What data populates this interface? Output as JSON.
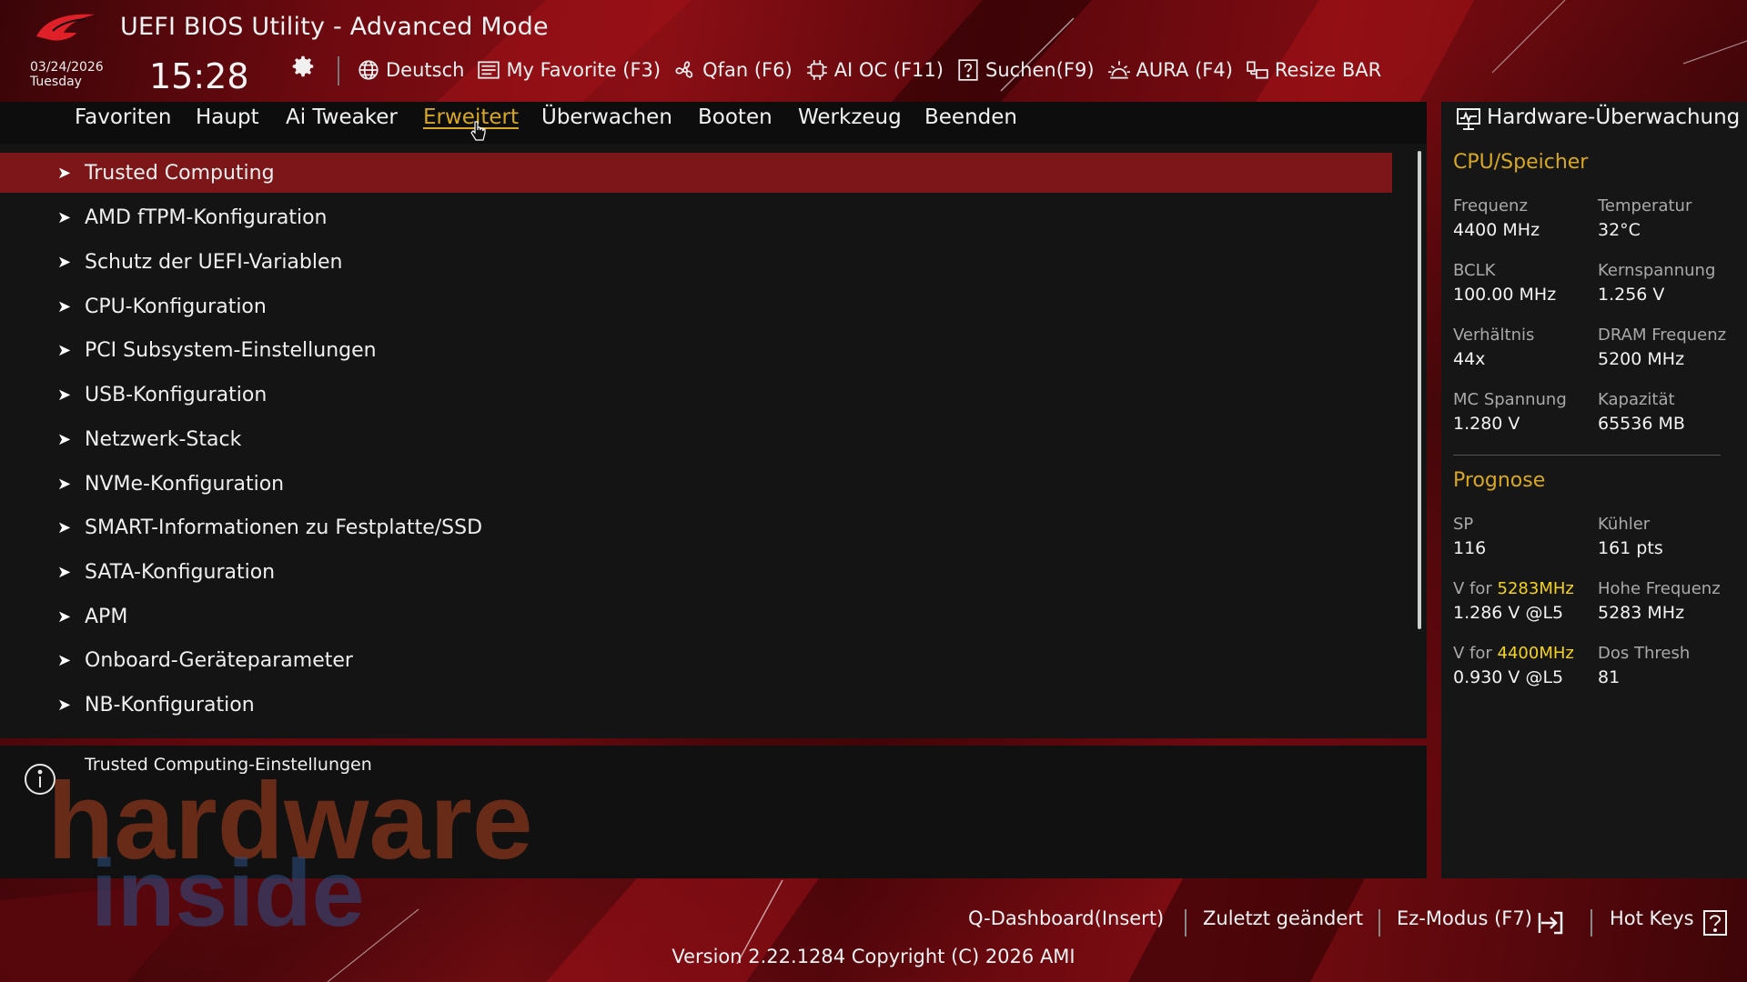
{
  "header": {
    "title": "UEFI BIOS Utility - Advanced Mode",
    "date": "03/24/2026",
    "weekday": "Tuesday",
    "time": "15:28",
    "toolbar": [
      {
        "label": "Deutsch",
        "icon": "globe-icon"
      },
      {
        "label": "My Favorite (F3)",
        "icon": "favorite-list-icon"
      },
      {
        "label": "Qfan (F6)",
        "icon": "fan-icon"
      },
      {
        "label": "AI OC (F11)",
        "icon": "ai-chip-icon"
      },
      {
        "label": "Suchen(F9)",
        "icon": "help-box-icon"
      },
      {
        "label": "AURA (F4)",
        "icon": "aura-light-icon"
      },
      {
        "label": "Resize BAR",
        "icon": "resize-bar-icon"
      }
    ]
  },
  "nav": {
    "tabs": [
      "Favoriten",
      "Haupt",
      "Ai Tweaker",
      "Erweitert",
      "Überwachen",
      "Booten",
      "Werkzeug",
      "Beenden"
    ],
    "active": "Erweitert"
  },
  "menu": {
    "items": [
      "Trusted Computing",
      "AMD fTPM-Konfiguration",
      "Schutz der UEFI-Variablen",
      "CPU-Konfiguration",
      "PCI Subsystem-Einstellungen",
      "USB-Konfiguration",
      "Netzwerk-Stack",
      "NVMe-Konfiguration",
      "SMART-Informationen zu Festplatte/SSD",
      "SATA-Konfiguration",
      "APM",
      "Onboard-Geräteparameter",
      "NB-Konfiguration"
    ],
    "selected": "Trusted Computing"
  },
  "info": {
    "text": "Trusted Computing-Einstellungen",
    "watermark_line1": "hardware",
    "watermark_line2": "inside"
  },
  "hw_monitor": {
    "title": "Hardware-Überwachung",
    "cpu_section": "CPU/Speicher",
    "cpu": [
      {
        "label": "Frequenz",
        "value": "4400 MHz"
      },
      {
        "label": "Temperatur",
        "value": "32°C"
      },
      {
        "label": "BCLK",
        "value": "100.00 MHz"
      },
      {
        "label": "Kernspannung",
        "value": "1.256 V"
      },
      {
        "label": "Verhältnis",
        "value": "44x"
      },
      {
        "label": "DRAM Frequenz",
        "value": "5200 MHz"
      },
      {
        "label": "MC Spannung",
        "value": "1.280 V"
      },
      {
        "label": "Kapazität",
        "value": "65536 MB"
      }
    ],
    "prognose_section": "Prognose",
    "prognose": [
      {
        "label": "SP",
        "value": "116"
      },
      {
        "label": "Kühler",
        "value": "161 pts"
      },
      {
        "label_prefix": "V for ",
        "label_highlight": "5283MHz",
        "value": "1.286 V @L5"
      },
      {
        "label": "Hohe Frequenz",
        "value": "5283 MHz"
      },
      {
        "label_prefix": "V for ",
        "label_highlight": "4400MHz",
        "value": "0.930 V @L5"
      },
      {
        "label": "Dos Thresh",
        "value": "81"
      }
    ]
  },
  "footer": {
    "qdashboard": "Q-Dashboard(Insert)",
    "last_modified": "Zuletzt geändert",
    "ez_mode": "Ez-Modus (F7)",
    "hot_keys": "Hot Keys",
    "version": "Version 2.22.1284 Copyright (C) 2026 AMI"
  },
  "colors": {
    "accent": "#d8a822",
    "selection": "#7c1618",
    "highlight": "#f5d31a",
    "brand_red": "#c0141c"
  }
}
